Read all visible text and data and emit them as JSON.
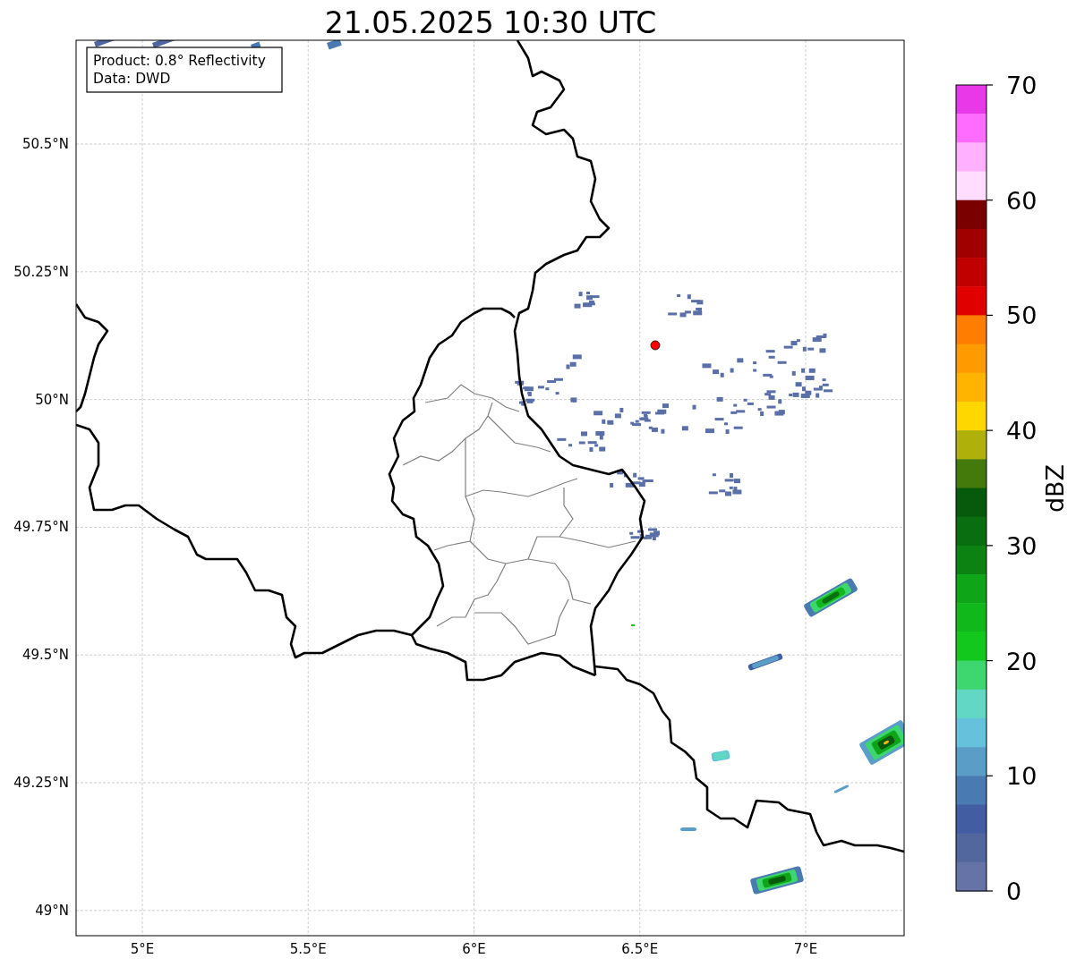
{
  "title": "21.05.2025 10:30 UTC",
  "info_box": [
    "Product: 0.8° Reflectivity",
    "Data: DWD"
  ],
  "map": {
    "x_ticks": [
      "5°E",
      "5.5°E",
      "6°E",
      "6.5°E",
      "7°E"
    ],
    "y_ticks": [
      "50.5°N",
      "50.25°N",
      "50°N",
      "49.75°N",
      "49.5°N",
      "49.25°N",
      "49°N"
    ]
  },
  "colorbar": {
    "label": "dBZ",
    "ticks": [
      "70",
      "60",
      "50",
      "40",
      "30",
      "20",
      "10",
      "0"
    ],
    "bands": [
      {
        "color": "#e838e8"
      },
      {
        "color": "#ff6cff"
      },
      {
        "color": "#ffb0ff"
      },
      {
        "color": "#ffddff"
      },
      {
        "color": "#7a0000"
      },
      {
        "color": "#a00000"
      },
      {
        "color": "#c00000"
      },
      {
        "color": "#e00000"
      },
      {
        "color": "#ff7d00"
      },
      {
        "color": "#ff9a00"
      },
      {
        "color": "#ffb400"
      },
      {
        "color": "#ffd700"
      },
      {
        "color": "#b0b00a"
      },
      {
        "color": "#447a0c"
      },
      {
        "color": "#075a0c"
      },
      {
        "color": "#086e10"
      },
      {
        "color": "#0b8212"
      },
      {
        "color": "#0ea618"
      },
      {
        "color": "#10b81c"
      },
      {
        "color": "#12c81c"
      },
      {
        "color": "#3ed66e"
      },
      {
        "color": "#62d8c4"
      },
      {
        "color": "#66c2dc"
      },
      {
        "color": "#5a9ec8"
      },
      {
        "color": "#4a7ab2"
      },
      {
        "color": "#435da3"
      },
      {
        "color": "#53679f"
      },
      {
        "color": "#6673a6"
      }
    ]
  }
}
